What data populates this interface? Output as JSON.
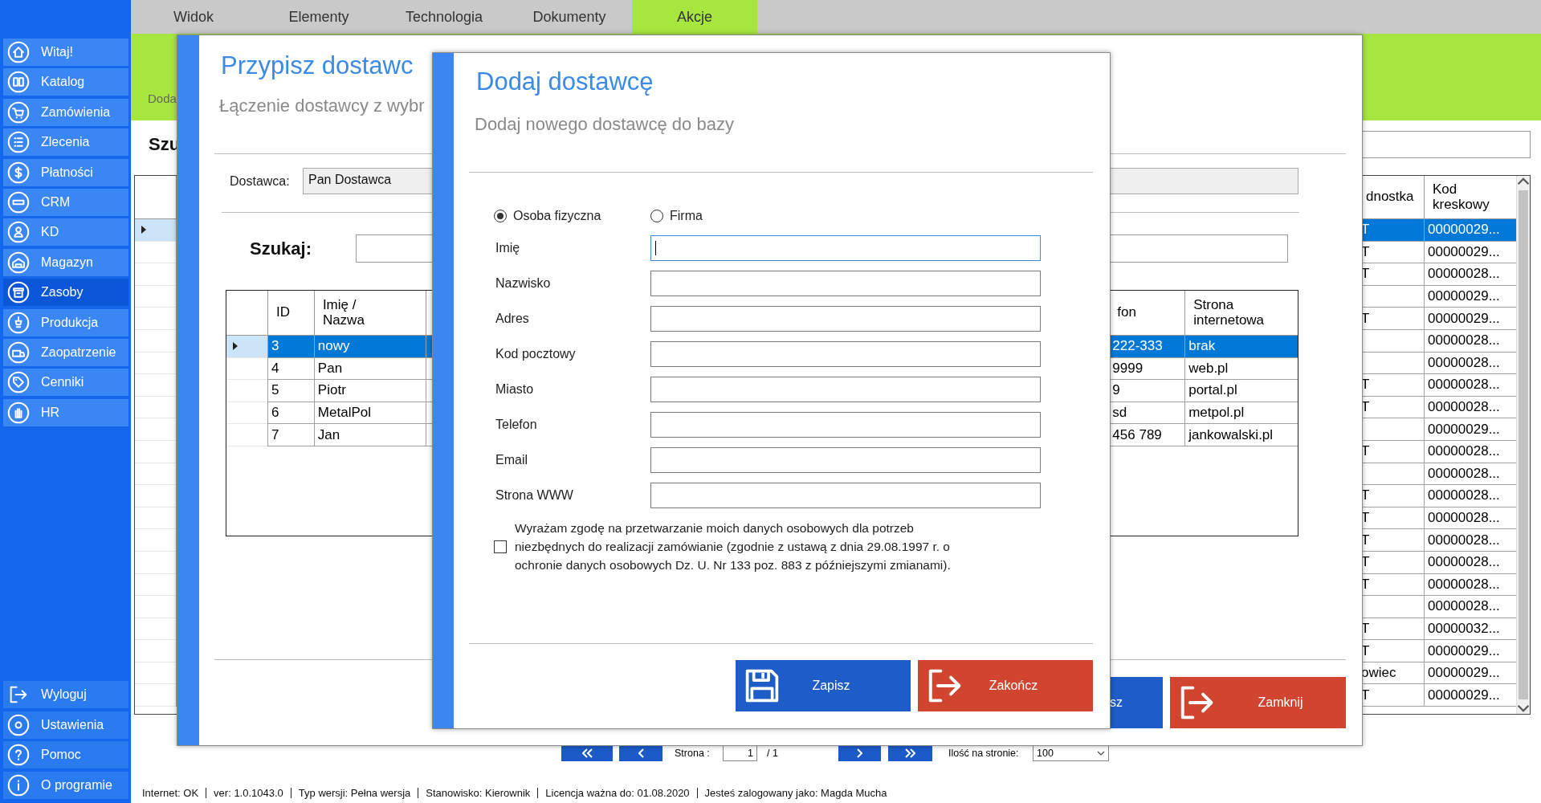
{
  "sidebar": {
    "items": [
      {
        "label": "Witaj!",
        "selected": false
      },
      {
        "label": "Katalog",
        "selected": false
      },
      {
        "label": "Zamówienia",
        "selected": false
      },
      {
        "label": "Zlecenia",
        "selected": false
      },
      {
        "label": "Płatności",
        "selected": false
      },
      {
        "label": "CRM",
        "selected": false
      },
      {
        "label": "KD",
        "selected": false
      },
      {
        "label": "Magazyn",
        "selected": false
      },
      {
        "label": "Zasoby",
        "selected": true
      },
      {
        "label": "Produkcja",
        "selected": false
      },
      {
        "label": "Zaopatrzenie",
        "selected": false
      },
      {
        "label": "Cenniki",
        "selected": false
      },
      {
        "label": "HR",
        "selected": false
      }
    ],
    "footer_items": [
      {
        "label": "Wyloguj"
      },
      {
        "label": "Ustawienia"
      },
      {
        "label": "Pomoc"
      },
      {
        "label": "O programie"
      }
    ]
  },
  "menu_tabs": [
    {
      "label": "Widok",
      "selected": false
    },
    {
      "label": "Elementy",
      "selected": false
    },
    {
      "label": "Technologia",
      "selected": false
    },
    {
      "label": "Dokumenty",
      "selected": false
    },
    {
      "label": "Akcje",
      "selected": true
    }
  ],
  "ribbon": {
    "label": "Doda"
  },
  "main": {
    "search_label": "Szu",
    "table": {
      "columns": [
        "dnostka",
        "Kod kreskowy"
      ],
      "rows": [
        {
          "cells": [
            "T",
            "00000029..."
          ],
          "selected": true
        },
        {
          "cells": [
            "T",
            "00000029..."
          ],
          "selected": false
        },
        {
          "cells": [
            "T",
            "00000028..."
          ],
          "selected": false
        },
        {
          "cells": [
            "",
            "00000029..."
          ],
          "selected": false
        },
        {
          "cells": [
            "T",
            "00000029..."
          ],
          "selected": false
        },
        {
          "cells": [
            "",
            "00000028..."
          ],
          "selected": false
        },
        {
          "cells": [
            "",
            "00000028..."
          ],
          "selected": false
        },
        {
          "cells": [
            "T",
            "00000028..."
          ],
          "selected": false
        },
        {
          "cells": [
            "T",
            "00000028..."
          ],
          "selected": false
        },
        {
          "cells": [
            "",
            "00000029..."
          ],
          "selected": false
        },
        {
          "cells": [
            "T",
            "00000028..."
          ],
          "selected": false
        },
        {
          "cells": [
            "",
            "00000028..."
          ],
          "selected": false
        },
        {
          "cells": [
            "T",
            "00000028..."
          ],
          "selected": false
        },
        {
          "cells": [
            "T",
            "00000028..."
          ],
          "selected": false
        },
        {
          "cells": [
            "T",
            "00000028..."
          ],
          "selected": false
        },
        {
          "cells": [
            "T",
            "00000028..."
          ],
          "selected": false
        },
        {
          "cells": [
            "T",
            "00000028..."
          ],
          "selected": false
        },
        {
          "cells": [
            "",
            "00000028..."
          ],
          "selected": false
        },
        {
          "cells": [
            "T",
            "00000032..."
          ],
          "selected": false
        },
        {
          "cells": [
            "T",
            "00000029..."
          ],
          "selected": false
        },
        {
          "cells": [
            "owiec",
            "00000029..."
          ],
          "selected": false
        },
        {
          "cells": [
            "T",
            "00000029..."
          ],
          "selected": false
        }
      ]
    },
    "pagination": {
      "page_label": "Strona :",
      "page": "1",
      "page_count": "/ 1",
      "per_page_label": "Ilość na stronie:",
      "per_page": "100"
    }
  },
  "status_bar": [
    "Internet: OK",
    "ver: 1.0.1043.0",
    "Typ wersji: Pełna wersja",
    "Stanowisko: Kierownik",
    "Licencja ważna do: 01.08.2020",
    "Jesteś zalogowany jako: Magda Mucha"
  ],
  "assign_dialog": {
    "title": "Przypisz dostawc",
    "subtitle": "Łączenie dostawcy z wybr",
    "supplier_label": "Dostawca:",
    "supplier_value": "Pan Dostawca",
    "search_label": "Szukaj:",
    "table": {
      "columns": [
        "ID",
        "Imię / Nazwa",
        "fon",
        "Strona internetowa"
      ],
      "rows": [
        {
          "cells": [
            "3",
            "nowy",
            "222-333",
            "brak"
          ],
          "selected": true
        },
        {
          "cells": [
            "4",
            "Pan",
            "9999",
            "web.pl"
          ],
          "selected": false
        },
        {
          "cells": [
            "5",
            "Piotr",
            "9",
            "portal.pl"
          ],
          "selected": false
        },
        {
          "cells": [
            "6",
            "MetalPol",
            "sd",
            "metpol.pl"
          ],
          "selected": false
        },
        {
          "cells": [
            "7",
            "Jan",
            "456 789",
            "jankowalski.pl"
          ],
          "selected": false
        }
      ]
    },
    "buttons": [
      {
        "label": "sz",
        "kind": "assign"
      },
      {
        "label": "Zamknij",
        "kind": "close"
      }
    ]
  },
  "add_dialog": {
    "title": "Dodaj dostawcę",
    "subtitle": "Dodaj nowego dostawcę do bazy",
    "person_types": [
      {
        "label": "Osoba fizyczna",
        "selected": true
      },
      {
        "label": "Firma",
        "selected": false
      }
    ],
    "fields": [
      {
        "label": "Imię",
        "focused": true
      },
      {
        "label": "Nazwisko",
        "focused": false
      },
      {
        "label": "Adres",
        "focused": false
      },
      {
        "label": "Kod pocztowy",
        "focused": false
      },
      {
        "label": "Miasto",
        "focused": false
      },
      {
        "label": "Telefon",
        "focused": false
      },
      {
        "label": "Email",
        "focused": false
      },
      {
        "label": "Strona WWW",
        "focused": false
      }
    ],
    "consent": {
      "text": "Wyrażam zgodę na przetwarzanie moich danych osobowych dla potrzeb niezbędnych do realizacji zamówianie (zgodnie z ustawą z dnia 29.08.1997 r. o ochronie danych osobowych Dz. U. Nr 133 poz. 883 z późniejszymi zmianami).",
      "checked": false
    },
    "buttons": [
      {
        "label": "Zapisz",
        "kind": "save"
      },
      {
        "label": "Zakończ",
        "kind": "exit"
      }
    ]
  }
}
